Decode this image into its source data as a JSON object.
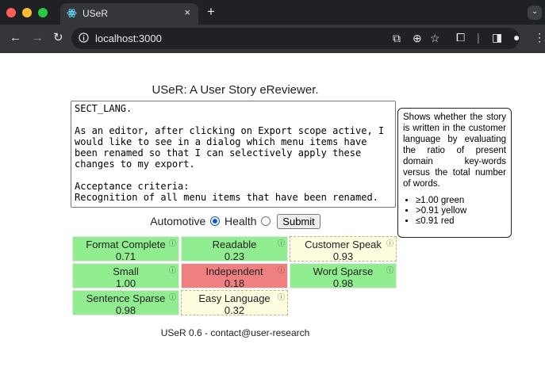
{
  "browser": {
    "tab_title": "USeR",
    "tab_close": "×",
    "new_tab": "+",
    "url": "localhost:3000",
    "colors": {
      "close": "#ff5f57",
      "minimize": "#febc2e",
      "maximize": "#28c840",
      "accent": "#0b57d0"
    }
  },
  "page": {
    "title": "USeR: A User Story eReviewer.",
    "story_text": "SECT_LANG.\n\nAs an editor, after clicking on Export scope active, I would like to see in a dialog which menu items have been renamed so that I can selectively apply these changes to my export.\n\nAcceptance criteria:\nRecognition of all menu items that have been renamed.",
    "tooltip": {
      "text": "Shows whether the story is written in the customer language by evaluating the ratio of present domain key-words versus the total number of words.",
      "items": [
        "≥1.00 green",
        ">0.91 yellow",
        "≤0.91 red"
      ]
    },
    "domain_options": [
      "Automotive",
      "Health"
    ],
    "selected_domain": "Automotive",
    "submit_label": "Submit",
    "info_glyph": "ⓘ",
    "metrics": [
      {
        "name": "Format Complete",
        "value": "0.71",
        "status": "green"
      },
      {
        "name": "Readable",
        "value": "0.23",
        "status": "green"
      },
      {
        "name": "Customer Speak",
        "value": "0.93",
        "status": "yellow"
      },
      {
        "name": "Small",
        "value": "1.00",
        "status": "green"
      },
      {
        "name": "Independent",
        "value": "0.18",
        "status": "red"
      },
      {
        "name": "Word Sparse",
        "value": "0.98",
        "status": "green"
      },
      {
        "name": "Sentence Sparse",
        "value": "0.98",
        "status": "green"
      },
      {
        "name": "Easy Language",
        "value": "0.32",
        "status": "yellow"
      }
    ],
    "footer": "USeR 0.6 - contact@user-research"
  }
}
